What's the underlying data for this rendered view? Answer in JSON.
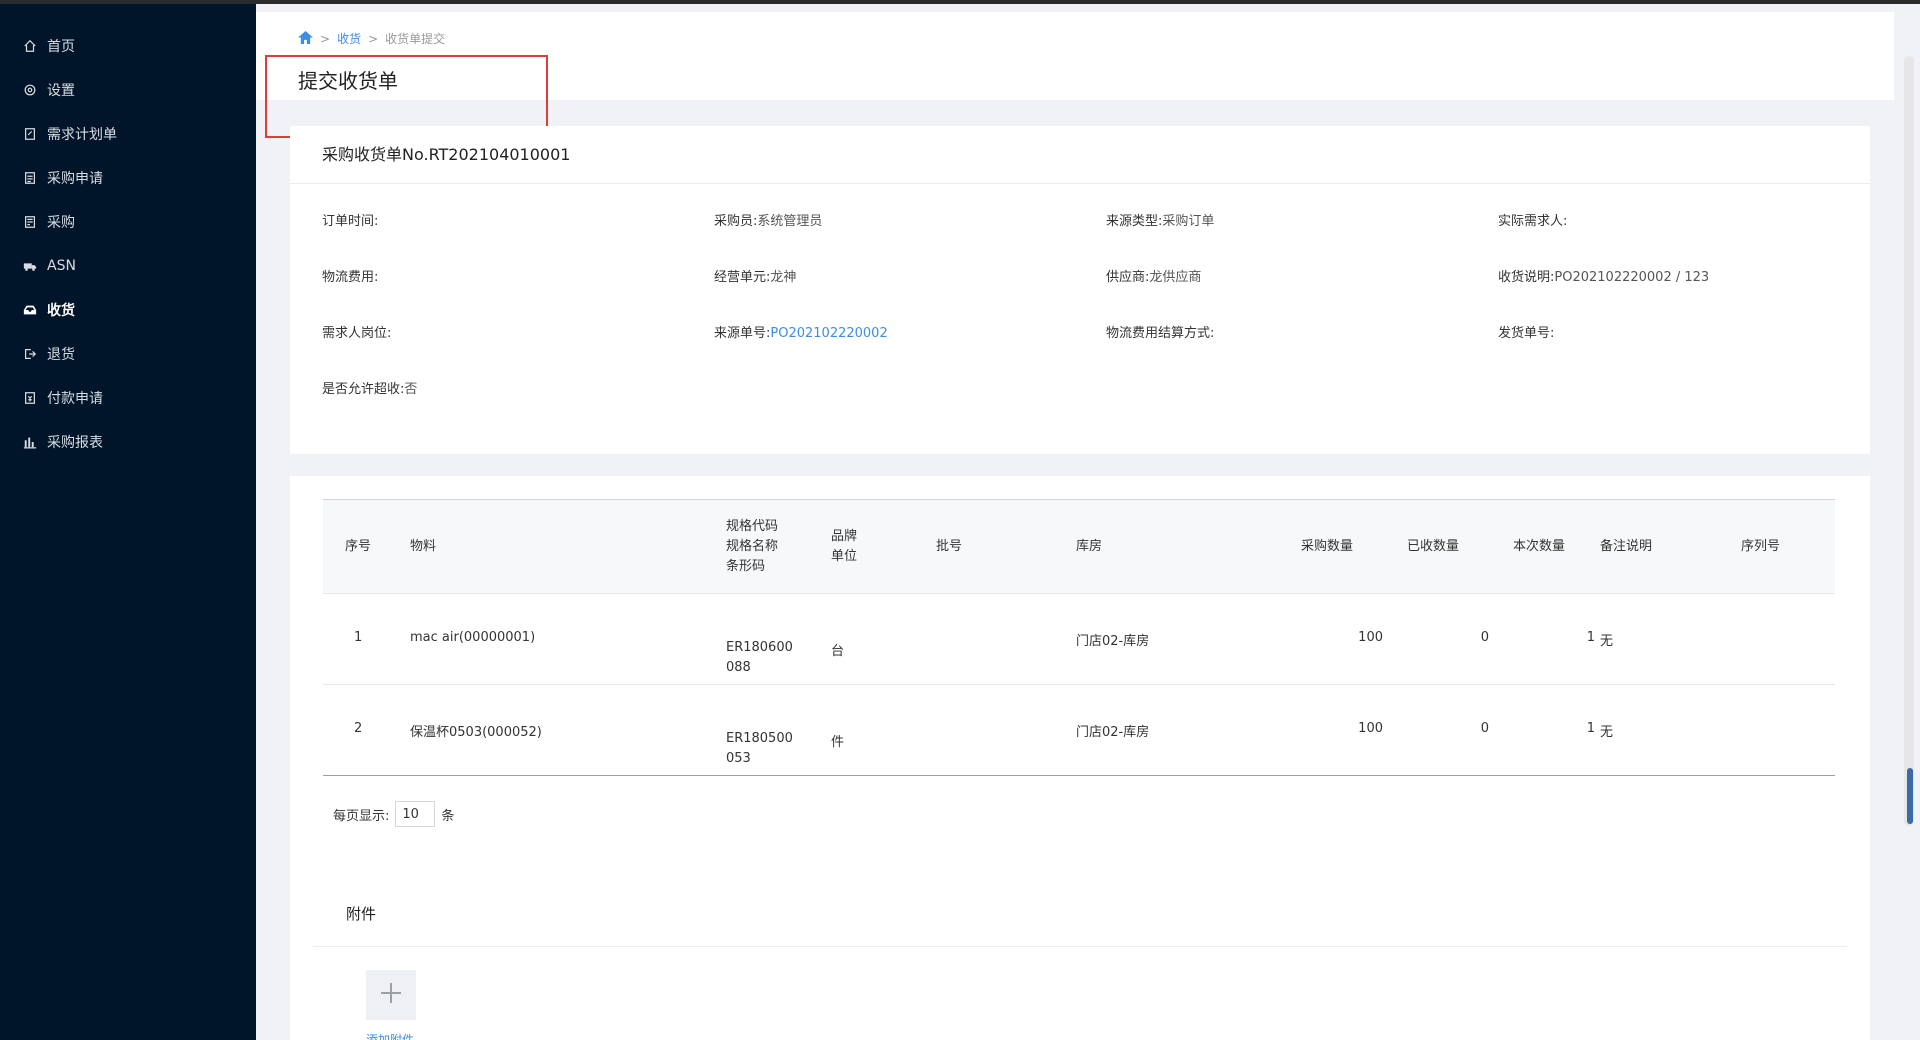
{
  "sidebar": {
    "items": [
      {
        "label": "首页",
        "icon": "home-icon"
      },
      {
        "label": "设置",
        "icon": "gear-icon"
      },
      {
        "label": "需求计划单",
        "icon": "document-edit-icon"
      },
      {
        "label": "采购申请",
        "icon": "clipboard-icon"
      },
      {
        "label": "采购",
        "icon": "list-icon"
      },
      {
        "label": "ASN",
        "icon": "truck-icon"
      },
      {
        "label": "收货",
        "icon": "inbox-icon",
        "active": true
      },
      {
        "label": "退货",
        "icon": "exit-icon"
      },
      {
        "label": "付款申请",
        "icon": "payment-icon"
      },
      {
        "label": "采购报表",
        "icon": "bar-chart-icon"
      }
    ]
  },
  "breadcrumb": {
    "level1": "收货",
    "level2": "收货单提交"
  },
  "page_title": "提交收货单",
  "order": {
    "title": "采购收货单No.RT202104010001",
    "fields": {
      "order_time": {
        "label": "订单时间:",
        "value": ""
      },
      "buyer": {
        "label": "采购员:",
        "value": "系统管理员"
      },
      "source_type": {
        "label": "来源类型:",
        "value": "采购订单"
      },
      "actual_requester": {
        "label": "实际需求人:",
        "value": ""
      },
      "logistics_fee": {
        "label": "物流费用:",
        "value": ""
      },
      "business_unit": {
        "label": "经营单元:",
        "value": "龙神"
      },
      "supplier": {
        "label": "供应商:",
        "value": "龙供应商"
      },
      "receipt_note": {
        "label": "收货说明:",
        "value": "PO202102220002 / 123"
      },
      "requester_post": {
        "label": "需求人岗位:",
        "value": ""
      },
      "source_no": {
        "label": "来源单号:",
        "value": "PO202102220002"
      },
      "fee_settlement": {
        "label": "物流费用结算方式:",
        "value": ""
      },
      "delivery_no": {
        "label": "发货单号:",
        "value": ""
      },
      "allow_over": {
        "label": "是否允许超收:",
        "value": "否"
      }
    }
  },
  "table": {
    "headers": {
      "seq": "序号",
      "material": "物料",
      "spec_code": "规格代码",
      "spec_name": "规格名称",
      "barcode": "条形码",
      "brand": "品牌",
      "unit": "单位",
      "batch": "批号",
      "warehouse": "库房",
      "purchase_qty": "采购数量",
      "received_qty": "已收数量",
      "current_qty": "本次数量",
      "remark": "备注说明",
      "serial": "序列号"
    },
    "rows": [
      {
        "seq": "1",
        "material": "mac air(00000001)",
        "code_line1": "ER180600",
        "code_line2": "088",
        "unit": "台",
        "warehouse": "门店02-库房",
        "purchase_qty": "100",
        "received_qty": "0",
        "current_qty": "1",
        "remark": "无"
      },
      {
        "seq": "2",
        "material": "保温杯0503(000052)",
        "code_line1": "ER180500",
        "code_line2": "053",
        "unit": "件",
        "warehouse": "门店02-库房",
        "purchase_qty": "100",
        "received_qty": "0",
        "current_qty": "1",
        "remark": "无"
      }
    ]
  },
  "pager": {
    "label": "每页显示:",
    "value": "10",
    "suffix": "条"
  },
  "attachment": {
    "title": "附件",
    "add_label": "添加附件"
  },
  "colors": {
    "sidebar_bg": "#001529",
    "link": "#3b8ee8",
    "highlight": "#e23b3b"
  }
}
